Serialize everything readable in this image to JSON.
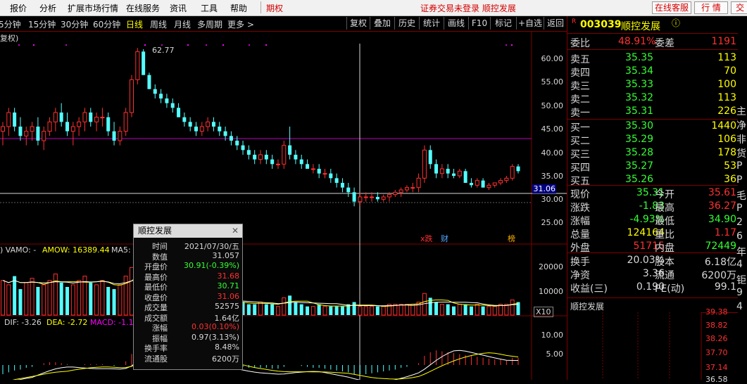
{
  "menu": {
    "items": [
      "报价",
      "分析",
      "扩展市场行情",
      "在线服务",
      "资讯",
      "工具",
      "帮助"
    ],
    "qihuo": "期权",
    "notice": "证券交易未登录  顺控发展",
    "btn_service": "在线客服",
    "btn_quote": "行 情",
    "btn_trade": "交 易"
  },
  "toolbar": {
    "periods": [
      "5分钟",
      "15分钟",
      "30分钟",
      "60分钟",
      "日线",
      "周线",
      "月线",
      "多周期",
      "更多 >"
    ],
    "active_period": "日线",
    "buttons": [
      "复权",
      "叠加",
      "历史",
      "统计",
      "画线",
      "F10",
      "标记",
      "+自选",
      "返回"
    ]
  },
  "chart": {
    "left_label": "复权)",
    "peak_label": "62.77",
    "price_ticks": [
      "60.00",
      "55.00",
      "50.00",
      "45.00",
      "40.00",
      "35.00",
      "30.00",
      "25.00"
    ],
    "current_price_tag": "31.06",
    "markers": {
      "m1": "x跌",
      "m2": "财",
      "m3": "榜"
    },
    "vol_header": {
      "prefix": ") VAMO: -",
      "amow_label": "AMOW: 16389.44",
      "ma5_label": "MA5:"
    },
    "vol_ticks": [
      "20000",
      "10000"
    ],
    "vol_unit": "X10",
    "macd_header": {
      "dif": "DIF: -3.26",
      "dea": "DEA: -2.72",
      "macd": "MACD: -1.1"
    },
    "macd_ticks": [
      "10.00",
      "5.00"
    ],
    "colors": {
      "up": "#ff3030",
      "down": "#54ffff",
      "ma_yellow": "#ffff00",
      "ma_white": "#ffffff",
      "ma_magenta": "#ff00ff"
    }
  },
  "chart_data": {
    "type": "candlestick",
    "title": "顺控发展",
    "ylim": [
      22,
      64
    ],
    "ohlc": [
      [
        45,
        47,
        42,
        46
      ],
      [
        46,
        50,
        44,
        49
      ],
      [
        49,
        50,
        45,
        46
      ],
      [
        46,
        48,
        43,
        44
      ],
      [
        44,
        46,
        42,
        45
      ],
      [
        45,
        47,
        43,
        46
      ],
      [
        46,
        48,
        42,
        43
      ],
      [
        43,
        46,
        41,
        45
      ],
      [
        45,
        48,
        44,
        47
      ],
      [
        47,
        50,
        45,
        49
      ],
      [
        49,
        51,
        46,
        47
      ],
      [
        47,
        49,
        44,
        45
      ],
      [
        45,
        47,
        42,
        46
      ],
      [
        46,
        48,
        44,
        47
      ],
      [
        47,
        50,
        45,
        49
      ],
      [
        49,
        50,
        46,
        47
      ],
      [
        47,
        49,
        45,
        48
      ],
      [
        48,
        50,
        46,
        48
      ],
      [
        48,
        49,
        44,
        45
      ],
      [
        45,
        47,
        42,
        43
      ],
      [
        43,
        46,
        42,
        45
      ],
      [
        45,
        50,
        44,
        49
      ],
      [
        49,
        57,
        48,
        56
      ],
      [
        56,
        62.77,
        55,
        62
      ],
      [
        62,
        62.5,
        57,
        57
      ],
      [
        57,
        57.5,
        54,
        54
      ],
      [
        54,
        55,
        52,
        53
      ],
      [
        53,
        54,
        51,
        52
      ],
      [
        52,
        53,
        50,
        51
      ],
      [
        51,
        52,
        49,
        50
      ],
      [
        50,
        51,
        48,
        48
      ],
      [
        48,
        49,
        46,
        47
      ],
      [
        47,
        48,
        45,
        46
      ],
      [
        46,
        47,
        44,
        45
      ],
      [
        45,
        47,
        44,
        46
      ],
      [
        46,
        48,
        45,
        47
      ],
      [
        47,
        48,
        45,
        46
      ],
      [
        46,
        47,
        44,
        45
      ],
      [
        45,
        46,
        43,
        44
      ],
      [
        44,
        45,
        42,
        43
      ],
      [
        43,
        44,
        41,
        42
      ],
      [
        42,
        43,
        40,
        41
      ],
      [
        41,
        42,
        39,
        40
      ],
      [
        40,
        41,
        38,
        39
      ],
      [
        39,
        41,
        38,
        40
      ],
      [
        40,
        41,
        38,
        39
      ],
      [
        39,
        40,
        37,
        38
      ],
      [
        38,
        39,
        37,
        38
      ],
      [
        38,
        43,
        37,
        42
      ],
      [
        42,
        46,
        39,
        40
      ],
      [
        40,
        41,
        38,
        39
      ],
      [
        39,
        40,
        37,
        38
      ],
      [
        38,
        39,
        37,
        37
      ],
      [
        37,
        38,
        36,
        37
      ],
      [
        37,
        38,
        35,
        36
      ],
      [
        36,
        37,
        35,
        36
      ],
      [
        36,
        37,
        34,
        35
      ],
      [
        35,
        36,
        33,
        34
      ],
      [
        34,
        35,
        32,
        33
      ],
      [
        33,
        34,
        31,
        32
      ],
      [
        32,
        33,
        29,
        30
      ],
      [
        30,
        32,
        29,
        31
      ],
      [
        31,
        32,
        30,
        31
      ],
      [
        31,
        32,
        30,
        31
      ],
      [
        31,
        32,
        30,
        30.5
      ],
      [
        30.5,
        31.5,
        30,
        31
      ],
      [
        31,
        32,
        30,
        31.5
      ],
      [
        31.5,
        32.5,
        31,
        32
      ],
      [
        32,
        33,
        31,
        32.5
      ],
      [
        32.5,
        33.5,
        32,
        33
      ],
      [
        33,
        34,
        32,
        33
      ],
      [
        33,
        36,
        32,
        35
      ],
      [
        35,
        42,
        34,
        41
      ],
      [
        41,
        42,
        37,
        38
      ],
      [
        38,
        39,
        35,
        36
      ],
      [
        36,
        38,
        35,
        37
      ],
      [
        37,
        38,
        35,
        36
      ],
      [
        36,
        37,
        35,
        35.5
      ],
      [
        35.5,
        37,
        35,
        36.5
      ],
      [
        36.5,
        37,
        34,
        34
      ],
      [
        34,
        35,
        33,
        33.5
      ],
      [
        33.5,
        35,
        33,
        34.5
      ],
      [
        34.5,
        35,
        33,
        33
      ],
      [
        33,
        34,
        32.5,
        33.5
      ],
      [
        33.5,
        34,
        33,
        34
      ],
      [
        34,
        35,
        33.5,
        34.5
      ],
      [
        34.5,
        35.5,
        34,
        35
      ],
      [
        35,
        38,
        34.5,
        37.5
      ],
      [
        37.5,
        38,
        36,
        36.5
      ]
    ],
    "volume": [
      16,
      14,
      18,
      12,
      15,
      17,
      13,
      14,
      16,
      19,
      15,
      13,
      14,
      16,
      18,
      15,
      14,
      16,
      13,
      12,
      14,
      18,
      22,
      24,
      20,
      17,
      15,
      13,
      11,
      10,
      9,
      8,
      7,
      7,
      8,
      7,
      6,
      7,
      6,
      6,
      5,
      6,
      5,
      5,
      6,
      5,
      5,
      4,
      8,
      9,
      6,
      5,
      4,
      4,
      5,
      4,
      4,
      4,
      4,
      5,
      6,
      4,
      4,
      4,
      4,
      4,
      5,
      5,
      5,
      5,
      5,
      6,
      10,
      8,
      6,
      5,
      5,
      4,
      5,
      5,
      4,
      5,
      4,
      4,
      4,
      5,
      5,
      7,
      6
    ],
    "macd": [
      -1,
      -0.8,
      -0.6,
      -0.5,
      -0.3,
      -0.2,
      0,
      0.2,
      0.3,
      0.3,
      0.2,
      0.1,
      0,
      0,
      0.1,
      0.1,
      0.1,
      0.1,
      0,
      -0.1,
      0,
      0.4,
      1.2,
      2.2,
      2.4,
      2.2,
      2,
      1.8,
      1.5,
      1.2,
      1,
      0.8,
      0.6,
      0.5,
      0.4,
      0.3,
      0.2,
      0.1,
      0,
      -0.1,
      -0.2,
      -0.2,
      -0.3,
      -0.3,
      -0.3,
      -0.3,
      -0.4,
      -0.4,
      -0.2,
      0,
      0,
      -0.1,
      -0.2,
      -0.3,
      -0.3,
      -0.4,
      -0.5,
      -0.6,
      -0.7,
      -0.8,
      -1,
      -1,
      -1,
      -0.9,
      -0.8,
      -0.7,
      -0.6,
      -0.5,
      -0.3,
      -0.2,
      0,
      0.2,
      1,
      1.4,
      1.6,
      1.5,
      1.4,
      1.3,
      1.2,
      1.1,
      1.0,
      0.9,
      0.8,
      0.7,
      0.6,
      0.6,
      0.5,
      0.8,
      0.8
    ]
  },
  "tooltip": {
    "title": "顺控发展",
    "rows": [
      {
        "k": "时间",
        "v": "2021/07/30/五",
        "c": "#d8d8d8"
      },
      {
        "k": "数值",
        "v": "31.057",
        "c": "#d8d8d8"
      },
      {
        "k": "开盘价",
        "v": "30.91(-0.39%)",
        "c": "#33ff33"
      },
      {
        "k": "最高价",
        "v": "31.68",
        "c": "#ff3030"
      },
      {
        "k": "最低价",
        "v": "30.71",
        "c": "#33ff33"
      },
      {
        "k": "收盘价",
        "v": "31.06",
        "c": "#ff3030"
      },
      {
        "k": "成交量",
        "v": "52575",
        "c": "#d8d8d8"
      },
      {
        "k": "成交额",
        "v": "1.64亿",
        "c": "#d8d8d8"
      },
      {
        "k": "涨幅",
        "v": "0.03(0.10%)",
        "c": "#ff3030"
      },
      {
        "k": "振幅",
        "v": "0.97(3.13%)",
        "c": "#d8d8d8"
      },
      {
        "k": "换手率",
        "v": "8.48%",
        "c": "#d8d8d8"
      },
      {
        "k": "流通股",
        "v": "6200万",
        "c": "#d8d8d8"
      }
    ]
  },
  "panel": {
    "r_badge": "R",
    "code": "003039",
    "name": "顺控发展",
    "weibi_label": "委比",
    "weibi": "48.91%",
    "weicha_label": "委差",
    "weicha": "1191",
    "asks": [
      {
        "l": "卖五",
        "p": "35.35",
        "v": "113"
      },
      {
        "l": "卖四",
        "p": "35.34",
        "v": "70"
      },
      {
        "l": "卖三",
        "p": "35.33",
        "v": "100"
      },
      {
        "l": "卖二",
        "p": "35.32",
        "v": "113"
      },
      {
        "l": "卖一",
        "p": "35.31",
        "v": "226"
      }
    ],
    "bids": [
      {
        "l": "买一",
        "p": "35.30",
        "v": "1440"
      },
      {
        "l": "买二",
        "p": "35.29",
        "v": "106"
      },
      {
        "l": "买三",
        "p": "35.28",
        "v": "178"
      },
      {
        "l": "买四",
        "p": "35.27",
        "v": "53"
      },
      {
        "l": "买五",
        "p": "35.26",
        "v": "36"
      }
    ],
    "stats": [
      {
        "l1": "现价",
        "v1": "35.31",
        "c1": "#33ff33",
        "l2": "今开",
        "v2": "35.61",
        "c2": "#ff3030"
      },
      {
        "l1": "涨跌",
        "v1": "-1.83",
        "c1": "#33ff33",
        "l2": "最高",
        "v2": "36.27",
        "c2": "#ff3030"
      },
      {
        "l1": "涨幅",
        "v1": "-4.93%",
        "c1": "#33ff33",
        "l2": "最低",
        "v2": "34.90",
        "c2": "#33ff33"
      },
      {
        "l1": "总量",
        "v1": "124164",
        "c1": "#ffff00",
        "l2": "量比",
        "v2": "1.17",
        "c2": "#ff3030"
      },
      {
        "l1": "外盘",
        "v1": "51715",
        "c1": "#ff3030",
        "l2": "内盘",
        "v2": "72449",
        "c2": "#33ff33"
      }
    ],
    "stats2": [
      {
        "l1": "换手",
        "v1": "20.03%",
        "l2": "股本",
        "v2": "6.18亿"
      },
      {
        "l1": "净资",
        "v1": "3.36",
        "l2": "流通",
        "v2": "6200万"
      },
      {
        "l1": "收益(三)",
        "v1": "0.190",
        "l2": "PE(动)",
        "v2": "99.1"
      }
    ],
    "mini_title": "顺控发展",
    "mini_ticks": [
      "39.38",
      "38.82",
      "38.26",
      "37.70",
      "37.14",
      "36.58"
    ],
    "edge_text": [
      "主",
      "净",
      "非",
      "货",
      "P",
      "P",
      "毛",
      "P",
      "2",
      "6",
      "年",
      "4",
      "钜",
      "9",
      "4"
    ]
  }
}
